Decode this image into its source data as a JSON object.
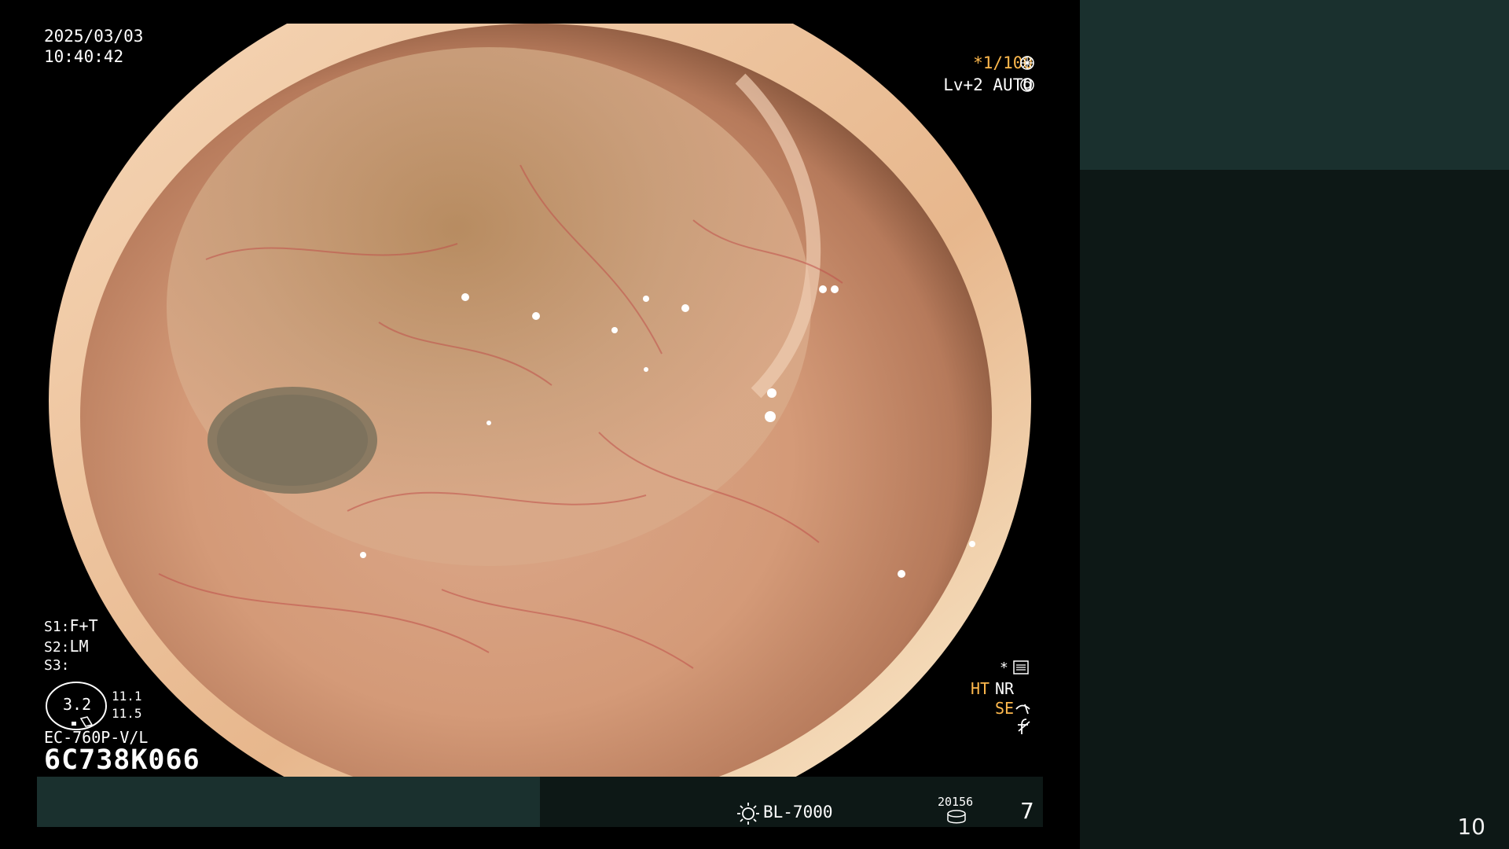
{
  "overlay": {
    "date": "2025/03/03",
    "time": "10:40:42",
    "shutter": "*1/100",
    "level": "Lv+2 AUTO",
    "s1_label": "S1:",
    "s1_value": "F+T",
    "s2_label": "S2:",
    "s2_value": "LM",
    "s3_label": "S3:",
    "gauge_value": "3.2",
    "gauge_a": "11.1",
    "gauge_b": "11.5",
    "scope_model": "EC-760P-V/L",
    "scope_serial": "6C738K066",
    "ht": "HT",
    "nr": "NR",
    "se": "SE"
  },
  "bottom_bar": {
    "light_source": "BL-7000",
    "counter": "20156",
    "frame_number": "7"
  },
  "side_panel": {
    "page_number": "10"
  },
  "colors": {
    "accent_orange": "#ffb94d",
    "panel_teal": "#1a302e",
    "panel_dark": "#0d1816",
    "tissue": "#d49a78"
  },
  "icons": [
    "shutter-icon",
    "auto-icon",
    "record-settings-icon",
    "structure-enhance-icon",
    "freeze-icon",
    "light-source-icon",
    "counter-icon",
    "gauge-icon"
  ]
}
